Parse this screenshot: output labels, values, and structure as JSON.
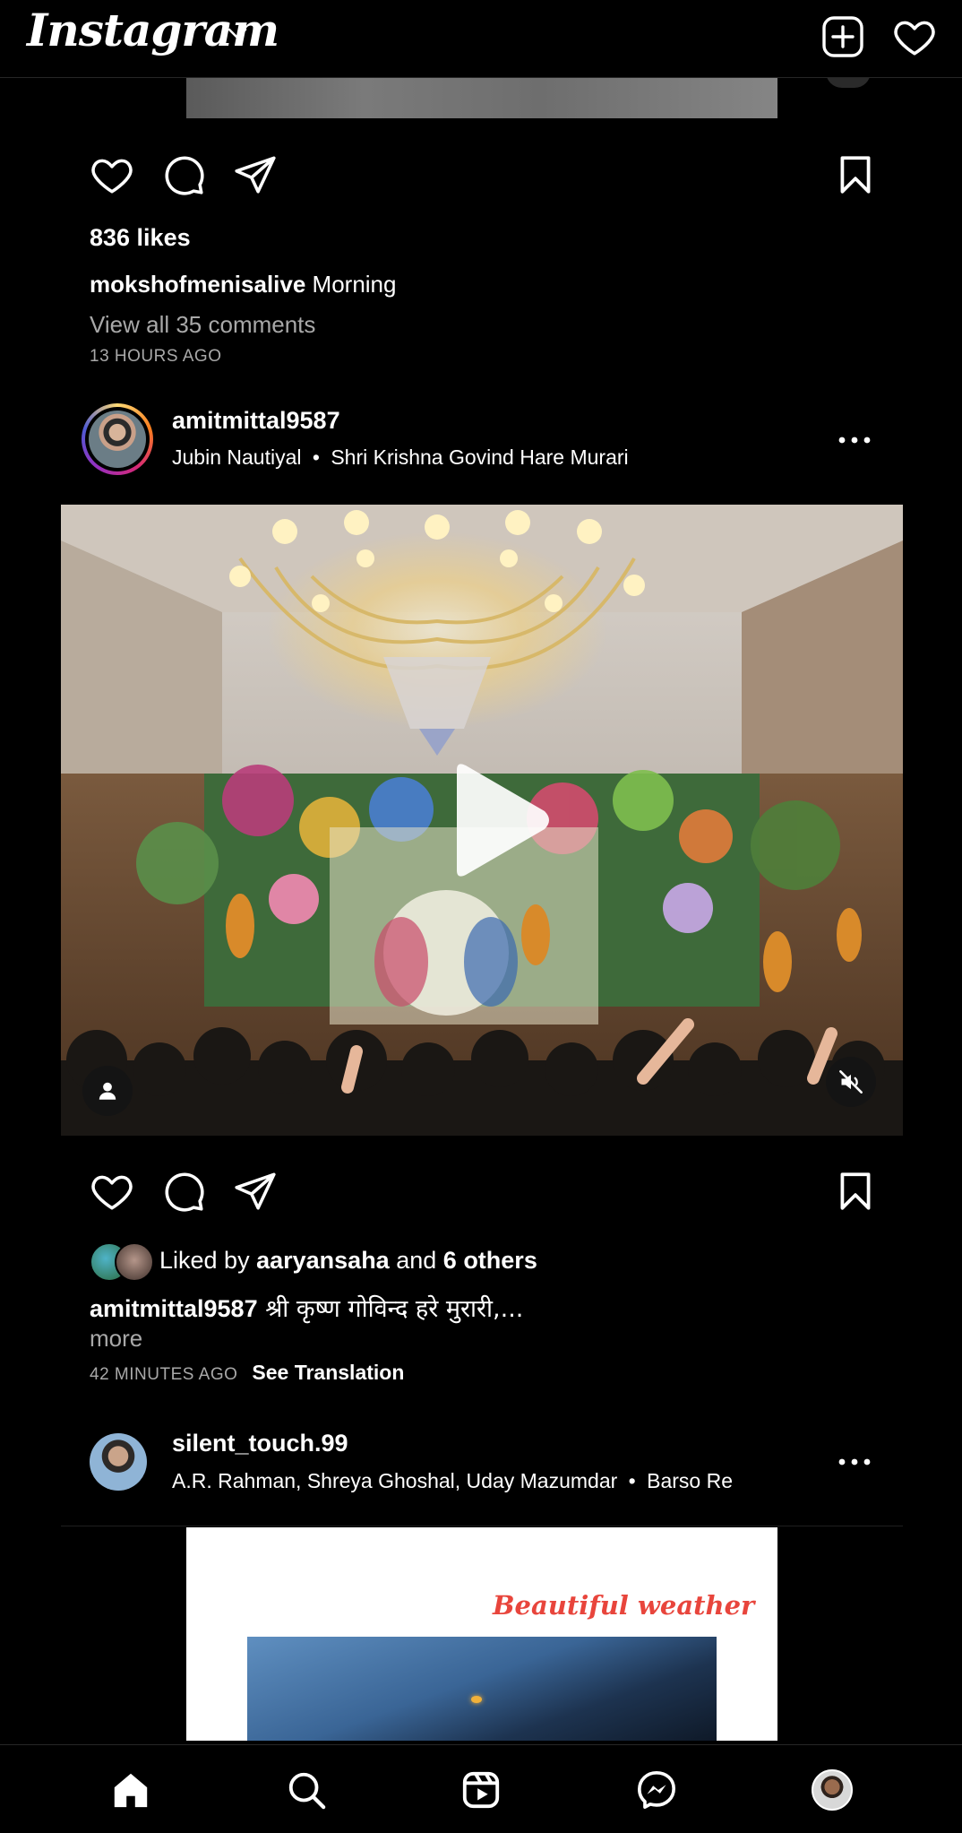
{
  "app": {
    "logo_text": "Instagram"
  },
  "post_prev": {
    "likes": "836 likes",
    "caption_user": "mokshofmenisalive",
    "caption_text": "Morning",
    "view_comments": "View all 35 comments",
    "timestamp": "13 HOURS AGO"
  },
  "post_main": {
    "username": "amitmittal9587",
    "audio_artist": "Jubin Nautiyal",
    "audio_sep": "•",
    "audio_title": "Shri Krishna Govind Hare Murari",
    "liked_by_prefix": "Liked by",
    "liked_by_user": "aaryansaha",
    "liked_by_and": "and",
    "liked_by_others": "6 others",
    "caption_user": "amitmittal9587",
    "caption_text": "श्री कृष्ण गोविन्द हरे मुरारी,...",
    "more": "more",
    "timestamp": "42 MINUTES AGO",
    "see_translation": "See Translation"
  },
  "post_next": {
    "username": "silent_touch.99",
    "audio_artist": "A.R. Rahman, Shreya Ghoshal, Uday Mazumdar",
    "audio_sep": "•",
    "audio_title": "Barso Re",
    "image_text": "Beautiful weather"
  },
  "colors": {
    "background": "#000000",
    "muted_text": "#a8a8a8",
    "ring_start": "#feda75",
    "ring_mid": "#d62976",
    "ring_end": "#962fbf",
    "image_caption": "#e8453c"
  },
  "icons": {
    "header": [
      "chevron-down-icon",
      "new-post-icon",
      "heart-icon"
    ],
    "actions": [
      "heart-icon",
      "comment-icon",
      "share-icon",
      "bookmark-icon"
    ],
    "nav": [
      "home-icon",
      "search-icon",
      "reels-icon",
      "messenger-icon",
      "profile-avatar"
    ]
  }
}
